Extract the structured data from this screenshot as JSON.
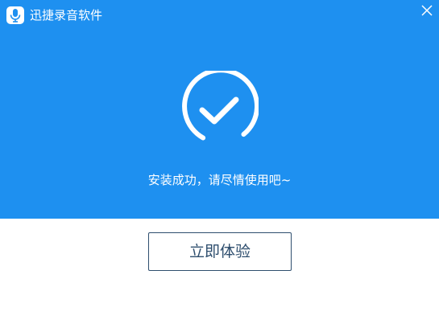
{
  "window": {
    "title": "迅捷录音软件",
    "app_icon": "microphone-icon",
    "close_icon": "close-icon"
  },
  "status": {
    "icon": "check-circle-icon",
    "message": "安装成功，请尽情使用吧~"
  },
  "actions": {
    "start_label": "立即体验"
  },
  "colors": {
    "banner": "#1e90f0",
    "button_text": "#2e4e6e",
    "background": "#ffffff"
  }
}
